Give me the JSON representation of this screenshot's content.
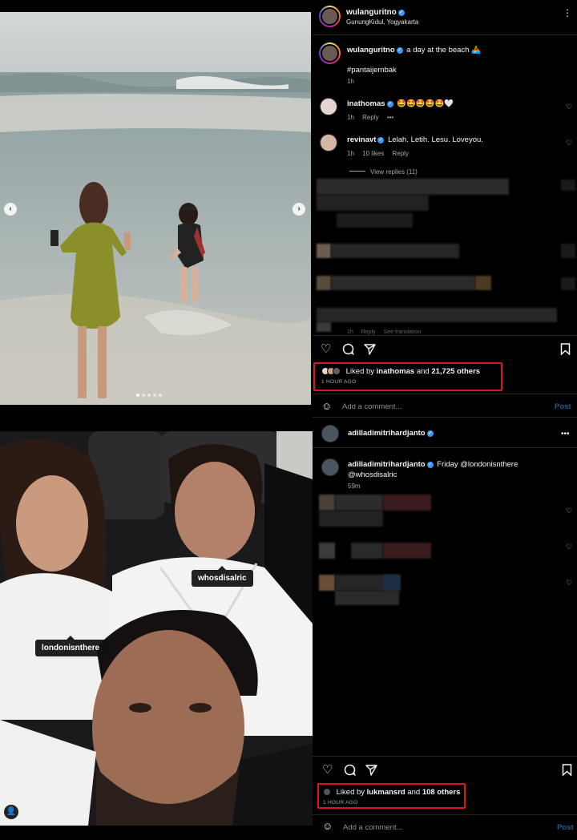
{
  "post1": {
    "username": "wulanguritno",
    "location": "GunungKidul, Yogyakarta",
    "more_icon": "more-vertical-icon",
    "caption": {
      "username": "wulanguritno",
      "text": "a day at the beach 🚣",
      "hashtag": "#pantaijembak",
      "time": "1h"
    },
    "comments": [
      {
        "username": "inathomas",
        "text": "🤩🤩🤩🤩🤩🤍",
        "time": "1h",
        "reply": "Reply"
      },
      {
        "username": "revinavt",
        "text": "Lelah. Letih. Lesu. Loveyou.",
        "time": "1h",
        "likes": "10 likes",
        "reply": "Reply"
      }
    ],
    "view_replies": "View replies (11)",
    "faded_row": {
      "time": "1h",
      "reply": "Reply",
      "see_translation": "See translation"
    },
    "likes_prefix": "Liked by",
    "liked_user": "inathomas",
    "likes_suffix": "and",
    "likes_others": "21,725 others",
    "time_ago": "1 HOUR AGO",
    "add_comment": "Add a comment...",
    "post_label": "Post"
  },
  "post2": {
    "username": "adilladimitrihardjanto",
    "more_icon": "more-horizontal-icon",
    "caption": {
      "username": "adilladimitrihardjanto",
      "text": "Friday @londonisnthere",
      "text2": "@whosdisalric",
      "time": "59m"
    },
    "tags": [
      "whosdisalric",
      "londonisnthere"
    ],
    "likes_prefix": "Liked by",
    "liked_user": "lukmansrd",
    "likes_suffix": "and",
    "likes_others": "108 others",
    "time_ago": "1 HOUR AGO",
    "add_comment": "Add a comment...",
    "post_label": "Post"
  },
  "colors": {
    "background": "#000000",
    "verified": "#3897f0",
    "highlight_box": "#e0141e",
    "post_button": "#1d5d8c"
  }
}
